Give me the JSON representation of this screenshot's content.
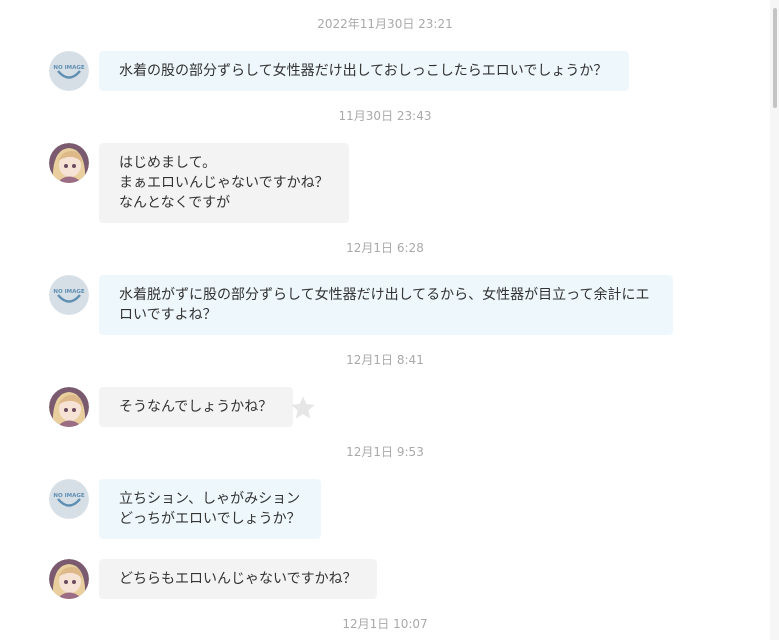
{
  "thread": {
    "timestamps": [
      "2022年11月30日 23:21",
      "11月30日 23:43",
      "12月1日 6:28",
      "12月1日 8:41",
      "12月1日 9:53",
      "12月1日 10:07"
    ],
    "messages": [
      {
        "sender": "questioner",
        "text": "水着の股の部分ずらして女性器だけ出しておしっこしたらエロいでしょうか？"
      },
      {
        "sender": "answerer",
        "text": "はじめまして。\nまぁエロいんじゃないですかね？\nなんとなくですが"
      },
      {
        "sender": "questioner",
        "text": "水着脱がずに股の部分ずらして女性器だけ出してるから、女性器が目立って余計にエ\nロいですよね？"
      },
      {
        "sender": "answerer",
        "text": "そうなんでしょうかね？"
      },
      {
        "sender": "questioner",
        "text": "立ちション、しゃがみション\nどっちがエロいでしょうか？"
      },
      {
        "sender": "answerer",
        "text": "どちらもエロいんじゃないですかね？"
      }
    ],
    "default_avatar_text": "NO IMAGE"
  },
  "icons": {
    "default_avatar": "no-image-avatar-icon",
    "user_avatar": "anime-girl-avatar",
    "reaction": "star-icon"
  },
  "colors": {
    "sent_bubble": "#eef7fb",
    "received_bubble": "#f3f3f3",
    "timestamp": "#a9a9a9",
    "star": "#e6e6e6"
  }
}
